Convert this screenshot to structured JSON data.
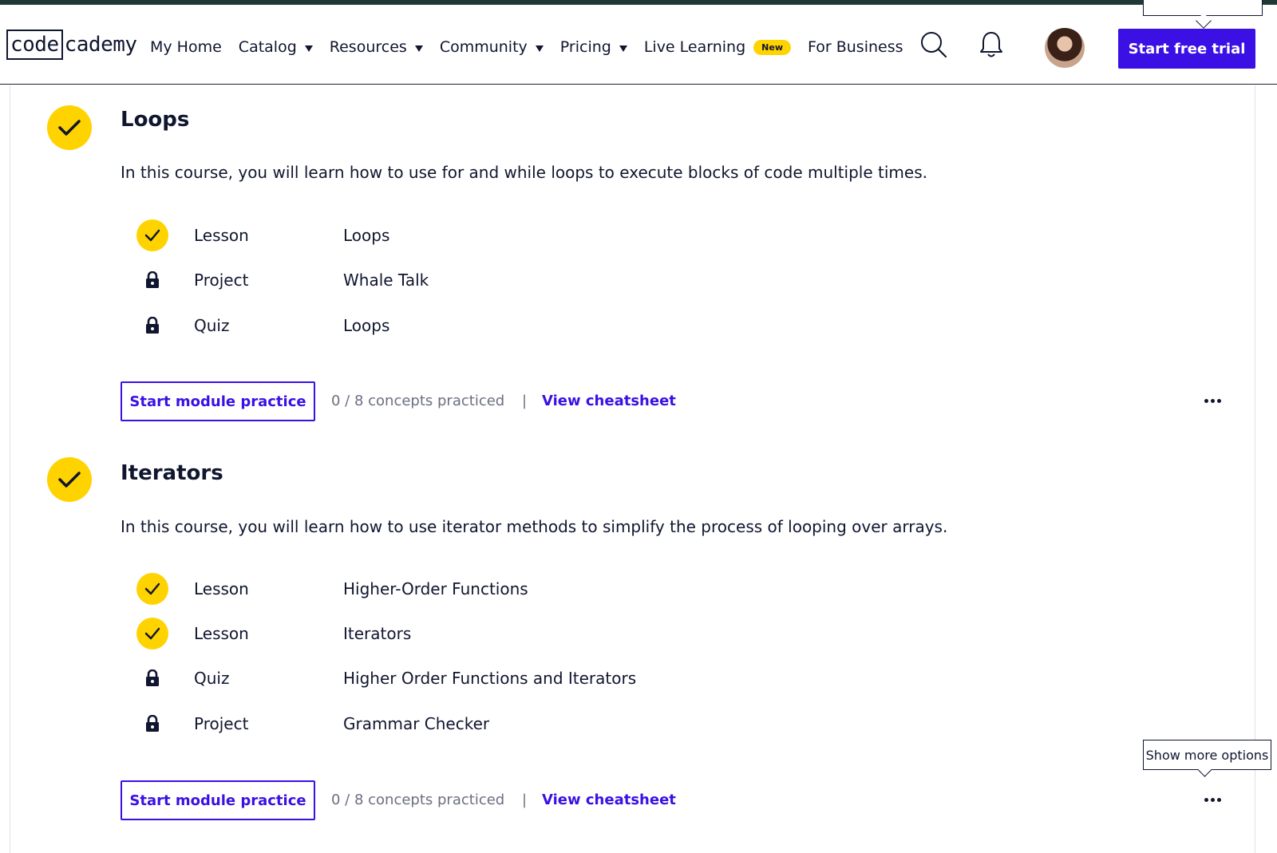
{
  "header": {
    "logo_boxed": "code",
    "logo_rest": "cademy",
    "nav": [
      {
        "label": "My Home",
        "has_caret": false
      },
      {
        "label": "Catalog",
        "has_caret": true
      },
      {
        "label": "Resources",
        "has_caret": true
      },
      {
        "label": "Community",
        "has_caret": true
      },
      {
        "label": "Pricing",
        "has_caret": true
      },
      {
        "label": "Live Learning",
        "has_caret": false,
        "badge": "New"
      },
      {
        "label": "For Business",
        "has_caret": false
      }
    ],
    "icons": [
      "search-icon",
      "bell-icon"
    ],
    "cta_label": "Start free trial"
  },
  "modules": [
    {
      "title": "Loops",
      "completed": true,
      "description": "In this course, you will learn how to use for and while loops to execute blocks of code multiple times.",
      "items": [
        {
          "type": "Lesson",
          "name": "Loops",
          "status": "completed"
        },
        {
          "type": "Project",
          "name": "Whale Talk",
          "status": "locked"
        },
        {
          "type": "Quiz",
          "name": "Loops",
          "status": "locked"
        }
      ],
      "practice_label": "Start module practice",
      "concepts_text": "0 / 8 concepts practiced",
      "separator": "|",
      "cheatsheet_label": "View cheatsheet"
    },
    {
      "title": "Iterators",
      "completed": true,
      "description": "In this course, you will learn how to use iterator methods to simplify the process of looping over arrays.",
      "items": [
        {
          "type": "Lesson",
          "name": "Higher-Order Functions",
          "status": "completed"
        },
        {
          "type": "Lesson",
          "name": "Iterators",
          "status": "completed"
        },
        {
          "type": "Quiz",
          "name": "Higher Order Functions and Iterators",
          "status": "locked"
        },
        {
          "type": "Project",
          "name": "Grammar Checker",
          "status": "locked"
        }
      ],
      "practice_label": "Start module practice",
      "concepts_text": "0 / 8 concepts practiced",
      "separator": "|",
      "cheatsheet_label": "View cheatsheet"
    }
  ],
  "tooltip": {
    "text": "Show more options"
  },
  "colors": {
    "accent": "#3a10e5",
    "check_yellow": "#ffd300",
    "text": "#10162f",
    "muted": "#6b6f80"
  }
}
